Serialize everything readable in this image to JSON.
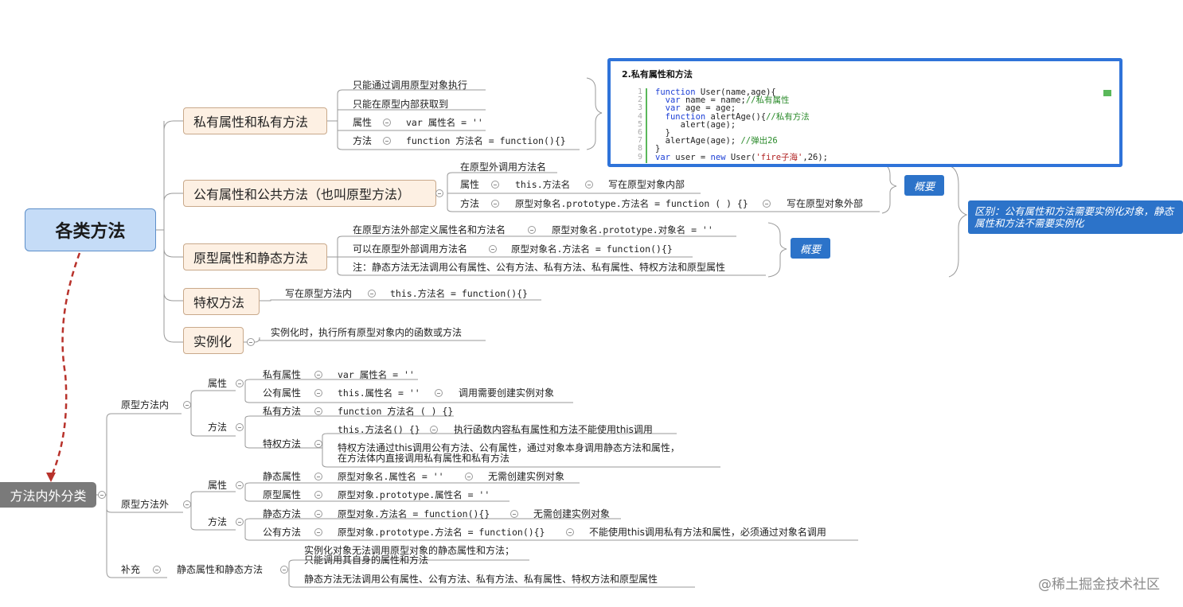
{
  "root": {
    "label": "各类方法"
  },
  "branches": [
    {
      "label": "私有属性和私有方法"
    },
    {
      "label": "公有属性和公共方法（也叫原型方法）"
    },
    {
      "label": "原型属性和静态方法"
    },
    {
      "label": "特权方法"
    },
    {
      "label": "实例化"
    }
  ],
  "b1": {
    "l1": "只能通过调用原型对象执行",
    "l2": "只能在原型内部获取到",
    "l3a": "属性",
    "l3b": "var 属性名 = ''",
    "l4a": "方法",
    "l4b": "function 方法名 = function(){}"
  },
  "b2": {
    "l1": "在原型外调用方法名",
    "l2a": "属性",
    "l2b": "this.方法名",
    "l2c": "写在原型对象内部",
    "l3a": "方法",
    "l3b": "原型对象名.prototype.方法名 = function ( ) {}",
    "l3c": "写在原型对象外部"
  },
  "b3": {
    "l1a": "在原型方法外部定义属性名和方法名",
    "l1b": "原型对象名.prototype.对象名 = ''",
    "l2a": "可以在原型外部调用方法名",
    "l2b": "原型对象名.方法名 = function(){}",
    "l3": "注：静态方法无法调用公有属性、公有方法、私有方法、私有属性、特权方法和原型属性"
  },
  "b4": {
    "l1a": "写在原型方法内",
    "l1b": "this.方法名 = function(){}"
  },
  "b5": {
    "l1": "实例化时，执行所有原型对象内的函数或方法"
  },
  "callouts": {
    "summary1": "概要",
    "summary2": "概要",
    "difference": "区别：公有属性和方法需要实例化对象，静态属性和方法不需要实例化"
  },
  "code": {
    "title": "2.私有属性和方法",
    "line_numbers": [
      "1",
      "2",
      "3",
      "4",
      "5",
      "6",
      "7",
      "8",
      "9"
    ]
  },
  "tree2": {
    "root": "方法内外分类",
    "inside": {
      "label": "原型方法内",
      "attr": "属性",
      "method": "方法",
      "priv_attr": "私有属性",
      "priv_attr_code": "var 属性名 = ''",
      "pub_attr": "公有属性",
      "pub_attr_code": "this.属性名 = ''",
      "pub_attr_note": "调用需要创建实例对象",
      "priv_method": "私有方法",
      "priv_method_code": "function 方法名 ( ) {}",
      "priv_method2": "特权方法",
      "priv2_code": "this.方法名() {}",
      "priv2_note": "执行函数内容私有属性和方法不能使用this调用",
      "priv2_desc1": "特权方法通过this调用公有方法、公有属性，通过对象本身调用静态方法和属性，",
      "priv2_desc2": "在方法体内直接调用私有属性和私有方法"
    },
    "outside": {
      "label": "原型方法外",
      "attr": "属性",
      "method": "方法",
      "static_attr": "静态属性",
      "static_attr_code": "原型对象名.属性名 = ''",
      "static_attr_note": "无需创建实例对象",
      "proto_attr": "原型属性",
      "proto_attr_code": "原型对象.prototype.属性名 = ''",
      "static_method": "静态方法",
      "static_method_code": "原型对象.方法名 = function(){}",
      "static_method_note": "无需创建实例对象",
      "pub_method": "公有方法",
      "pub_method_code": "原型对象.prototype.方法名 = function(){}",
      "pub_method_note": "不能使用this调用私有方法和属性，必须通过对象名调用"
    },
    "supplement": {
      "label": "补充",
      "sub": "静态属性和静态方法",
      "note1": "实例化对象无法调用原型对象的静态属性和方法；",
      "note2": "只能调用其自身的属性和方法",
      "note3": "静态方法无法调用公有属性、公有方法、私有方法、私有属性、特权方法和原型属性"
    }
  },
  "watermark": "@稀土掘金技术社区"
}
